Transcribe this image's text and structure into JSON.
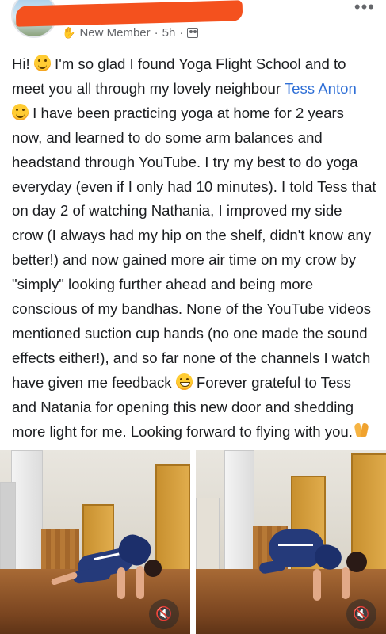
{
  "post": {
    "author_badge": "New Member",
    "meta_separator": "·",
    "timestamp": "5h",
    "more_label": "•••",
    "text": {
      "p1": "Hi! ",
      "p2": " I'm so glad I found Yoga Flight School and to meet you all through my lovely neighbour ",
      "mention": "Tess Anton",
      "p3": " I have been practicing yoga at home for 2 years now, and learned to do some arm balances and headstand through YouTube. I try my best to do yoga everyday (even if I only had 10 minutes). I told Tess that on day 2 of watching Nathania, I improved my side crow (I always had my hip on the shelf, didn't know any better!) and now gained more air time on my crow by \"simply\" looking further ahead and being more conscious of my bandhas. None of the YouTube videos mentioned suction cup hands (no one made the sound effects either!), and so far none of the channels I watch have given me feedback ",
      "p4": " Forever grateful to Tess and Natania for opening this new door and shedding more light for me. Looking forward to flying with you."
    },
    "icons": {
      "wave": "waving-hand-icon",
      "group": "group-privacy-icon",
      "emoji_smile": "smiling-face-icon",
      "emoji_grin": "grinning-face-icon",
      "emoji_pray": "folded-hands-icon",
      "sound": "sound-toggle-icon"
    },
    "photos": [
      {
        "name": "yoga-photo-crow-side",
        "sound_label": "🔇"
      },
      {
        "name": "yoga-photo-crow-front",
        "sound_label": "🔇"
      }
    ]
  }
}
